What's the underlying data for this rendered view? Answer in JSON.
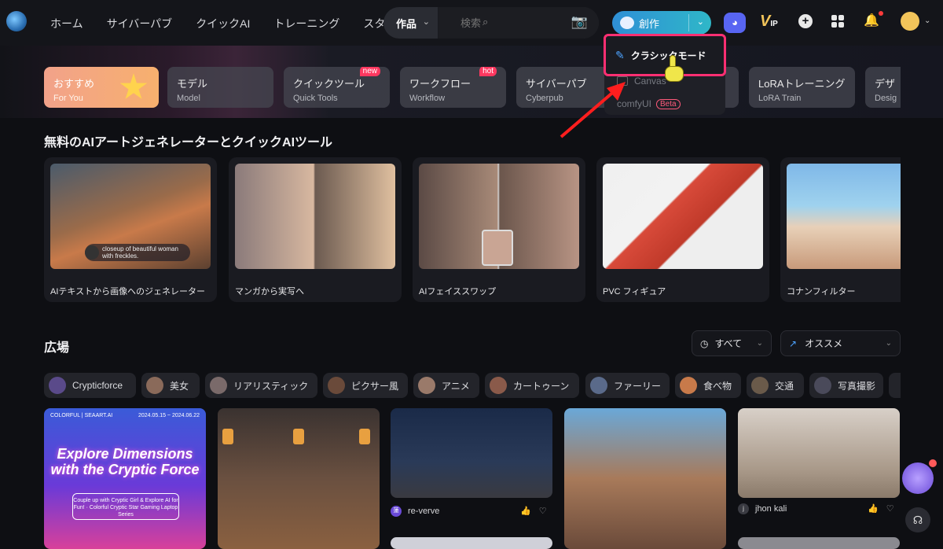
{
  "nav": {
    "items": [
      "ホーム",
      "サイバーパブ",
      "クイックAI",
      "トレーニング",
      "スタジオ"
    ]
  },
  "search": {
    "category": "作品",
    "placeholder": "検索"
  },
  "create_button": {
    "label": "創作"
  },
  "header_badge": {
    "vip": "V",
    "vip_sub": "IP"
  },
  "dropdown": {
    "highlighted": "クラシックモード",
    "items": [
      {
        "label": "Canvas"
      },
      {
        "label": "comfyUI",
        "badge": "Beta"
      }
    ]
  },
  "categories": [
    {
      "title": "おすすめ",
      "sub": "For You"
    },
    {
      "title": "モデル",
      "sub": "Model"
    },
    {
      "title": "クイックツール",
      "sub": "Quick Tools",
      "badge": "new"
    },
    {
      "title": "ワークフロー",
      "sub": "Workflow",
      "badge": "hot"
    },
    {
      "title": "サイバーパブ",
      "sub": "Cyberpub"
    },
    {
      "title": "",
      "sub": ""
    },
    {
      "title": "LoRAトレーニング",
      "sub": "LoRA Train"
    },
    {
      "title": "デザ",
      "sub": "Desig"
    }
  ],
  "section_tools": {
    "title": "無料のAIアートジェネレーターとクイックAIツール",
    "prompt_text": "closeup of beautiful woman with freckles.",
    "tools": [
      "AIテキストから画像へのジェネレーター",
      "マンガから実写へ",
      "AIフェイススワップ",
      "PVC フィギュア",
      "コナンフィルター"
    ]
  },
  "section_plaza": {
    "title": "広場",
    "filter_time": "すべて",
    "filter_sort": "オススメ",
    "tags": [
      "Crypticforce",
      "美女",
      "リアリスティック",
      "ピクサー風",
      "アニメ",
      "カートゥーン",
      "ファーリー",
      "食べ物",
      "交通",
      "写真撮影"
    ]
  },
  "feed": {
    "promo": {
      "brand": "COLORFUL | SEAART.AI",
      "date": "2024.05.15 ~ 2024.06.22",
      "headline": "Explore Dimensions with the Cryptic Force",
      "pill": "Couple up with Cryptic Girl & Explore AI for Fun! · Colorful Cryptic Star Gaming Laptop Series"
    },
    "authors": [
      {
        "name": "re-verve",
        "avatar_text": "蓮"
      },
      {
        "name": "jhon kali",
        "avatar_text": "j"
      }
    ]
  },
  "colors": {
    "accent": "#2f8fd6",
    "highlight_border": "#ff2f72",
    "active_category": "#f2a28a"
  }
}
